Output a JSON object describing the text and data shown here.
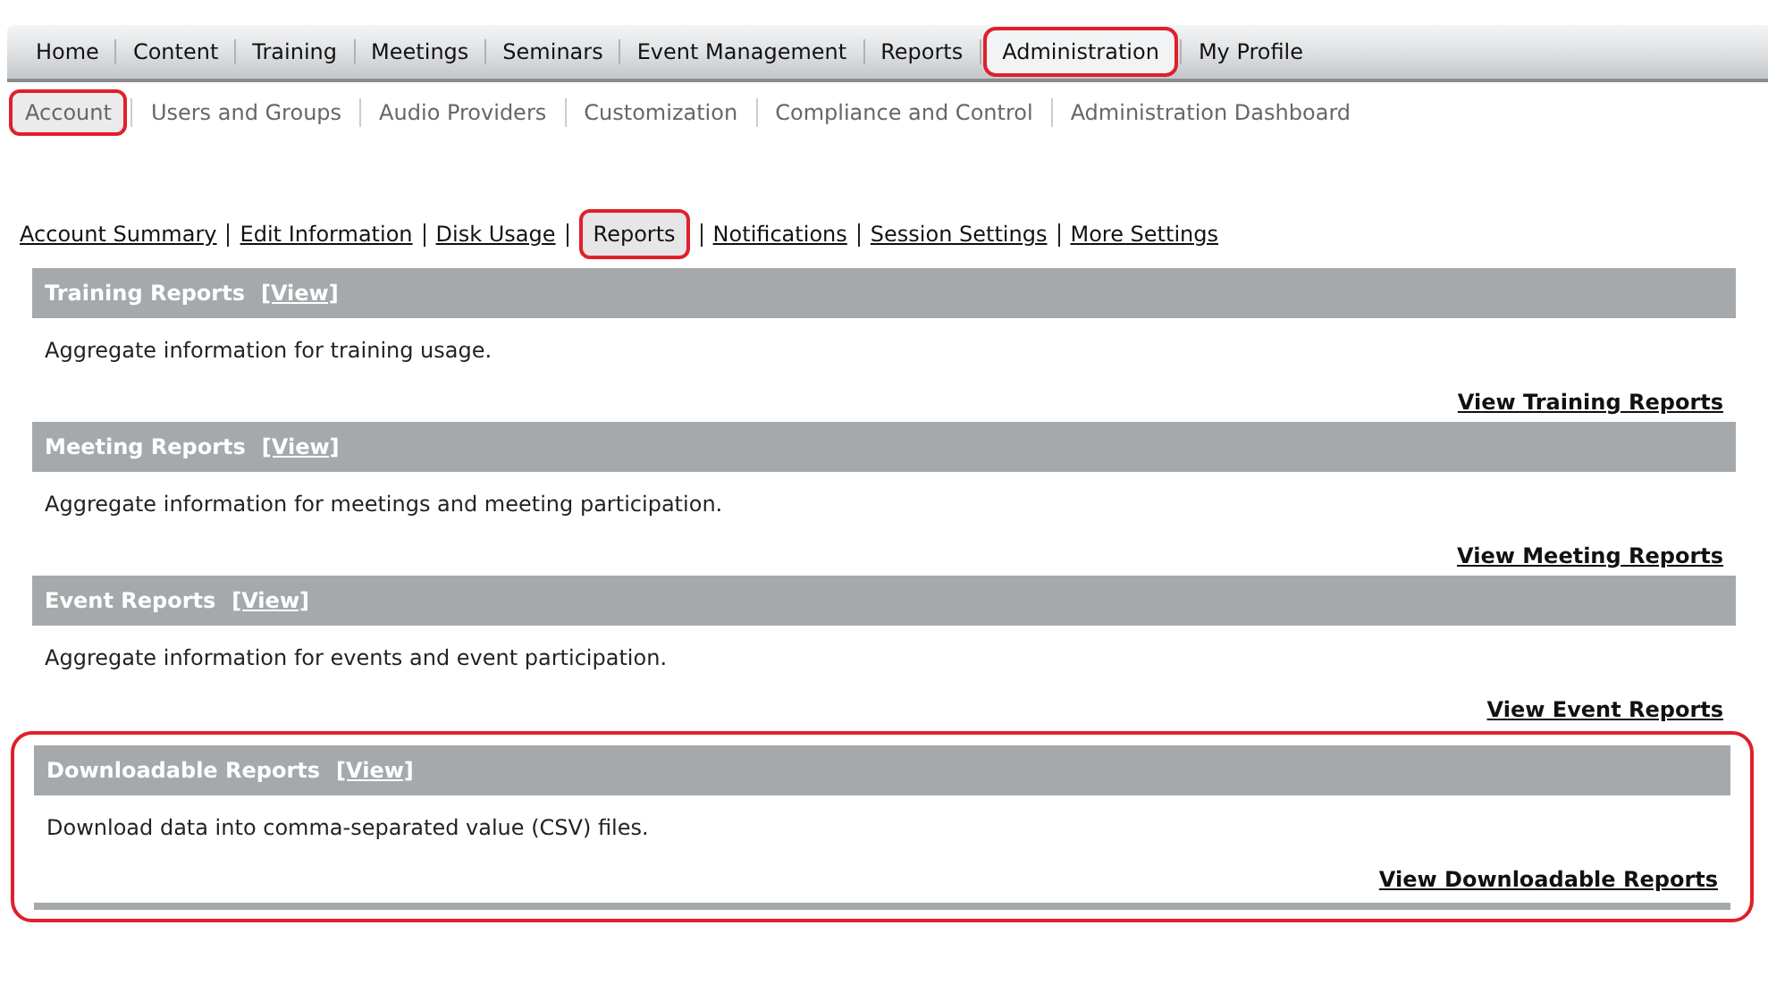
{
  "main_nav": [
    {
      "label": "Home",
      "selected": false
    },
    {
      "label": "Content",
      "selected": false
    },
    {
      "label": "Training",
      "selected": false
    },
    {
      "label": "Meetings",
      "selected": false
    },
    {
      "label": "Seminars",
      "selected": false
    },
    {
      "label": "Event Management",
      "selected": false
    },
    {
      "label": "Reports",
      "selected": false
    },
    {
      "label": "Administration",
      "selected": true
    },
    {
      "label": "My Profile",
      "selected": false
    }
  ],
  "sub_nav": [
    {
      "label": "Account",
      "selected": true
    },
    {
      "label": "Users and Groups",
      "selected": false
    },
    {
      "label": "Audio Providers",
      "selected": false
    },
    {
      "label": "Customization",
      "selected": false
    },
    {
      "label": "Compliance and Control",
      "selected": false
    },
    {
      "label": "Administration Dashboard",
      "selected": false
    }
  ],
  "account_links": [
    {
      "label": "Account Summary",
      "selected": false
    },
    {
      "label": "Edit Information",
      "selected": false
    },
    {
      "label": "Disk Usage",
      "selected": false
    },
    {
      "label": "Reports",
      "selected": true
    },
    {
      "label": "Notifications",
      "selected": false
    },
    {
      "label": "Session Settings",
      "selected": false
    },
    {
      "label": "More Settings",
      "selected": false
    }
  ],
  "sections": [
    {
      "title": "Training Reports",
      "view": "[View]",
      "description": "Aggregate information for training usage.",
      "link": "View Training Reports",
      "highlighted": false
    },
    {
      "title": "Meeting Reports",
      "view": "[View]",
      "description": "Aggregate information for meetings and meeting participation.",
      "link": "View Meeting Reports",
      "highlighted": false
    },
    {
      "title": "Event Reports",
      "view": "[View]",
      "description": "Aggregate information for events and event participation.",
      "link": "View Event Reports",
      "highlighted": false
    },
    {
      "title": "Downloadable Reports",
      "view": "[View]",
      "description": "Download data into comma-separated value (CSV) files.",
      "link": "View Downloadable Reports",
      "highlighted": true
    }
  ]
}
